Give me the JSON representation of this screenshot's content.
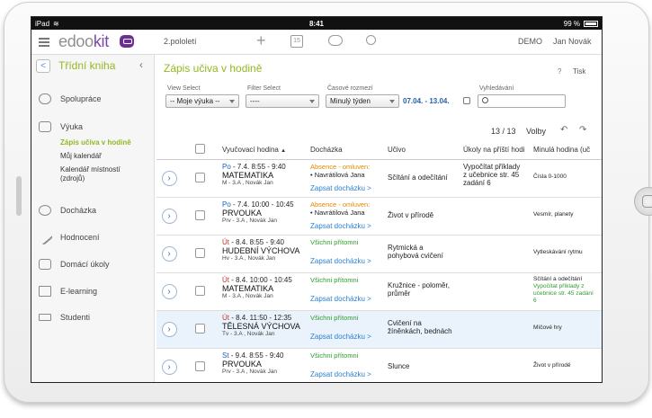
{
  "status": {
    "device": "iPad",
    "time": "8:41",
    "battery": "99 %"
  },
  "topbar": {
    "brand_prefix": "edoo",
    "brand_suffix": "kit",
    "period": "2.pololetí",
    "calendar_day": "15",
    "demo": "DEMO",
    "user": "Jan Novák"
  },
  "sidebar": {
    "title": "Třídní kniha",
    "items": [
      {
        "label": "Spolupráce",
        "icon": "chat-bubble-icon"
      },
      {
        "label": "Výuka",
        "icon": "book-icon"
      },
      {
        "label": "Docházka",
        "icon": "clock-icon"
      },
      {
        "label": "Hodnocení",
        "icon": "pencil-icon"
      },
      {
        "label": "Domácí úkoly",
        "icon": "briefcase-icon"
      },
      {
        "label": "E-learning",
        "icon": "folder-icon"
      },
      {
        "label": "Studenti",
        "icon": "graduation-cap-icon"
      }
    ],
    "sub": [
      "Zápis učiva v hodině",
      "Můj kalendář",
      "Kalendář místností",
      "(zdrojů)"
    ]
  },
  "main": {
    "title": "Zápis učiva v hodině",
    "help": "?",
    "print": "Tisk",
    "filters": {
      "view_label": "View Select",
      "view_value": "-- Moje výuka --",
      "filter_label": "Filter Select",
      "filter_value": "----",
      "time_label": "Časové rozmezí",
      "time_value": "Minulý týden",
      "range": "07.04. - 13.04.",
      "search_label": "Vyhledávání"
    },
    "counts": "13 / 13",
    "volby": "Volby",
    "columns": [
      "Vyučovací hodina",
      "Docházka",
      "Učivo",
      "Úkoly na příští hodi",
      "Minulá hodina (uč"
    ],
    "rows": [
      {
        "day": "Po",
        "time": " - 7.4. 8:55 - 9:40",
        "subject": "MATEMATIKA",
        "meta": "M - 3.A , Novák Jan",
        "att_status": "Absence - omluven:",
        "att_names": [
          "Navrátilová Jana"
        ],
        "att_link": "Zapsat docházku >",
        "topic": "Sčítání a odečítání",
        "homework": "Vypočítat příklady z učebnice str. 45 zadání 6",
        "prev": "Čísla 0-1000",
        "prev2": ""
      },
      {
        "day": "Po",
        "time": " - 7.4. 10:00 - 10:45",
        "subject": "PRVOUKA",
        "meta": "Prv - 3.A , Novák Jan",
        "att_status": "Absence - omluven:",
        "att_names": [
          "Navrátilová Jana"
        ],
        "att_link": "Zapsat docházku >",
        "topic": "Život v přírodě",
        "homework": "",
        "prev": "Vesmír, planety",
        "prev2": ""
      },
      {
        "day": "Út",
        "time": " - 8.4. 8:55 - 9:40",
        "subject": "HUDEBNÍ VÝCHOVA",
        "meta": "Hv - 3.A , Novák Jan",
        "att_status": "Všichni přítomni",
        "att_names": [],
        "att_link": "Zapsat docházku >",
        "topic": "Rytmická a pohybová cvičení",
        "homework": "",
        "prev": "Vytleskávání rytmu",
        "prev2": ""
      },
      {
        "day": "Út",
        "time": " - 8.4. 10:00 - 10:45",
        "subject": "MATEMATIKA",
        "meta": "M - 3.A , Novák Jan",
        "att_status": "Všichni přítomni",
        "att_names": [],
        "att_link": "Zapsat docházku >",
        "topic": "Kružnice - poloměr, průměr",
        "homework": "",
        "prev": "Sčítání a odečítání",
        "prev2": "Vypočítat příklady z učebnice str. 45 zadání 6"
      },
      {
        "day": "Út",
        "time": " - 8.4. 11:50 - 12:35",
        "subject": "TĚLESNÁ VÝCHOVA",
        "meta": "Tv - 3.A , Novák Jan",
        "att_status": "Všichni přítomni",
        "att_names": [],
        "att_link": "Zapsat docházku >",
        "topic": "Cvičení na žíněnkách, bednách",
        "homework": "",
        "prev": "Míčové hry",
        "prev2": ""
      },
      {
        "day": "St",
        "time": " - 9.4. 8:55 - 9:40",
        "subject": "PRVOUKA",
        "meta": "Prv - 3.A , Novák Jan",
        "att_status": "Všichni přítomni",
        "att_names": [],
        "att_link": "Zapsat docházku >",
        "topic": "Slunce",
        "homework": "",
        "prev": "Život v přírodě",
        "prev2": ""
      }
    ]
  }
}
